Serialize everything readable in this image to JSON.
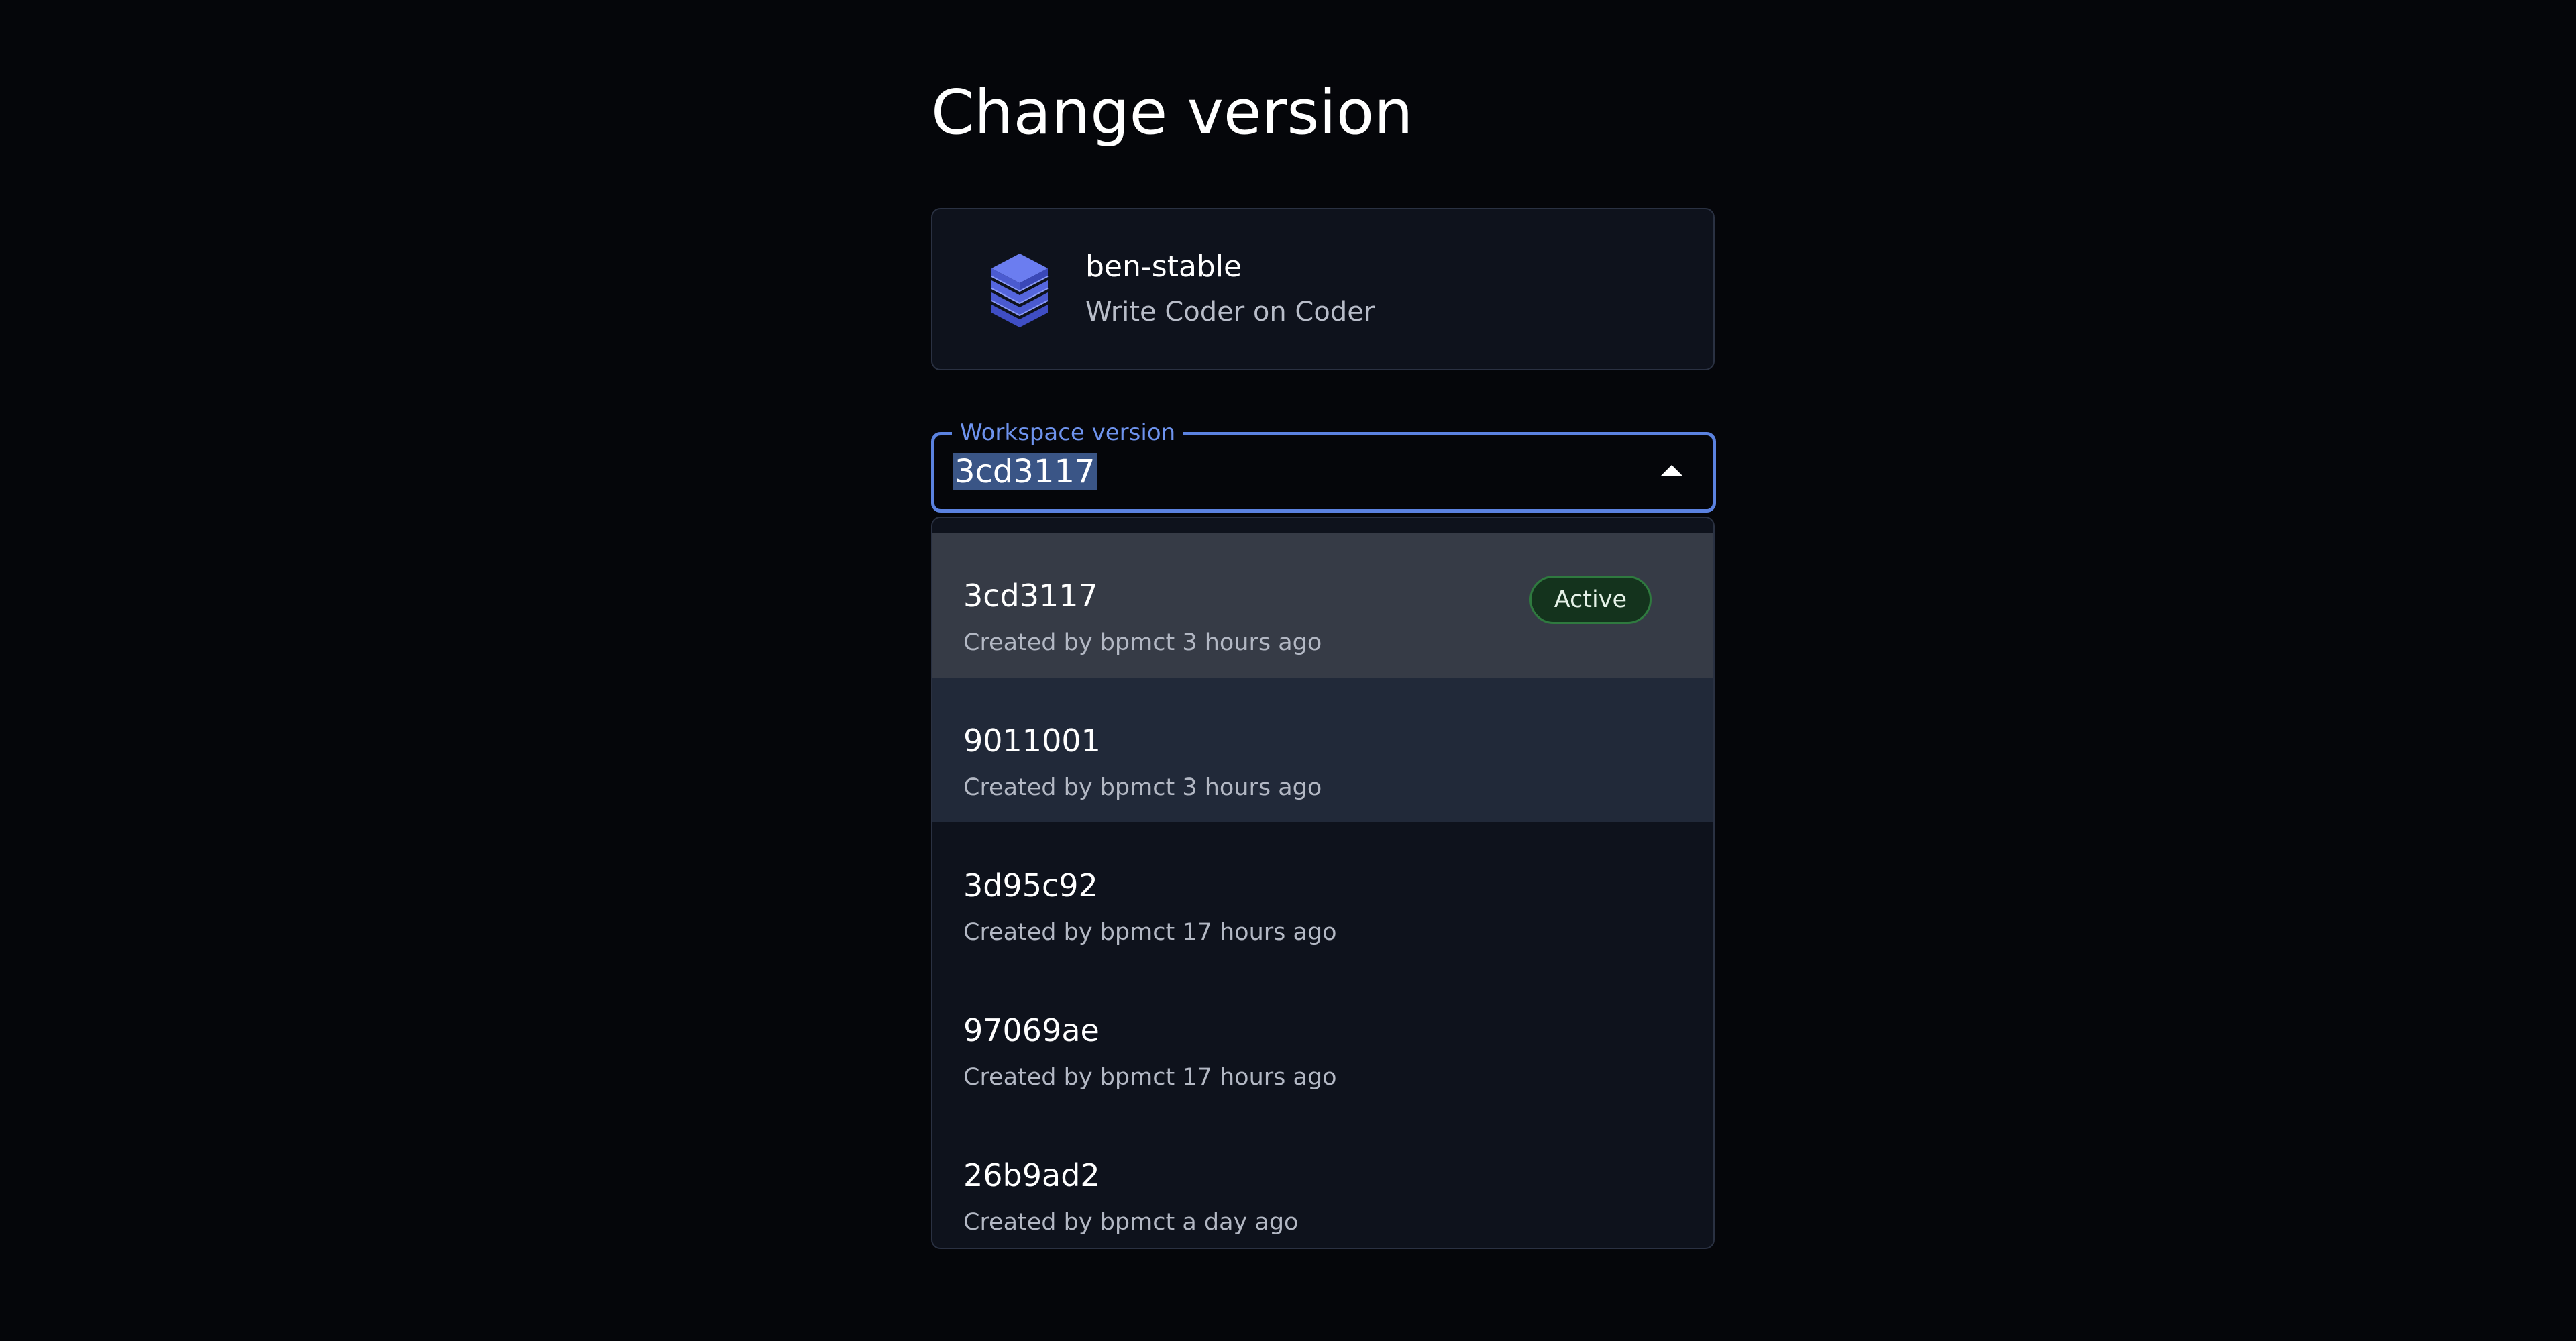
{
  "page": {
    "title": "Change version"
  },
  "template": {
    "name": "ben-stable",
    "description": "Write Coder on Coder",
    "icon": "layers-stack-icon"
  },
  "version_select": {
    "label": "Workspace version",
    "value": "3cd3117",
    "expanded": true,
    "accent_color": "#5b82e0"
  },
  "versions": [
    {
      "name": "3cd3117",
      "meta": "Created by bpmct 3 hours ago",
      "badge": "Active",
      "state": "selected"
    },
    {
      "name": "9011001",
      "meta": "Created by bpmct 3 hours ago",
      "badge": "",
      "state": "hover"
    },
    {
      "name": "3d95c92",
      "meta": "Created by bpmct 17 hours ago",
      "badge": "",
      "state": ""
    },
    {
      "name": "97069ae",
      "meta": "Created by bpmct 17 hours ago",
      "badge": "",
      "state": ""
    },
    {
      "name": "26b9ad2",
      "meta": "Created by bpmct a day ago",
      "badge": "",
      "state": ""
    }
  ]
}
